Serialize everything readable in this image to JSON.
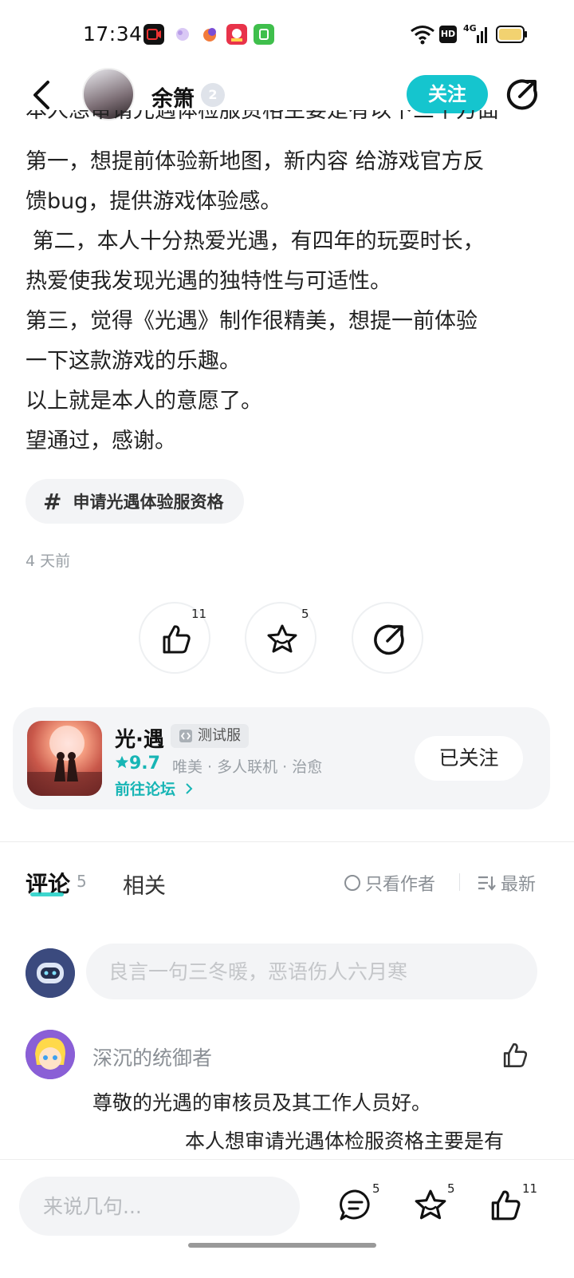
{
  "status_bar": {
    "time": "17:34",
    "hd": "HD",
    "network": "4G"
  },
  "header": {
    "username": "余箫",
    "level": "2",
    "follow_label": "关注"
  },
  "post": {
    "cut_line": "本人想审请光遇体检服资格主要是有以下三个方面",
    "lines": [
      "第一，想提前体验新地图，新内容 给游戏官方反",
      "馈bug，提供游戏体验感。",
      " 第二，本人十分热爱光遇，有四年的玩耍时长，",
      "热爱使我发现光遇的独特性与可适性。",
      "第三，觉得《光遇》制作很精美，想提一前体验",
      "一下这款游戏的乐趣。",
      "以上就是本人的意愿了。",
      "望通过，感谢。"
    ],
    "topic": "申请光遇体验服资格",
    "time_ago": "4 天前",
    "like_count": "11",
    "star_count": "5"
  },
  "game": {
    "title": "光·遇",
    "badge": "测试服",
    "score": "9.7",
    "tags": "唯美 · 多人联机 · 治愈",
    "forum_link": "前往论坛",
    "followed_label": "已关注"
  },
  "comments_section": {
    "tab_comments": "评论",
    "tab_comments_count": "5",
    "tab_related": "相关",
    "only_author": "只看作者",
    "sort": "最新",
    "input_placeholder": "良言一句三冬暖，恶语伤人六月寒"
  },
  "comment": {
    "author": "深沉的统御者",
    "line1": "尊敬的光遇的审核员及其工作人员好。",
    "line2": "本人想审请光遇体检服资格主要是有"
  },
  "bottom_bar": {
    "placeholder": "来说几句...",
    "comment_count": "5",
    "star_count": "5",
    "like_count": "11"
  },
  "colors": {
    "accent": "#15c5ce",
    "teal_text": "#17b5b5",
    "muted": "#9aa0a6"
  }
}
